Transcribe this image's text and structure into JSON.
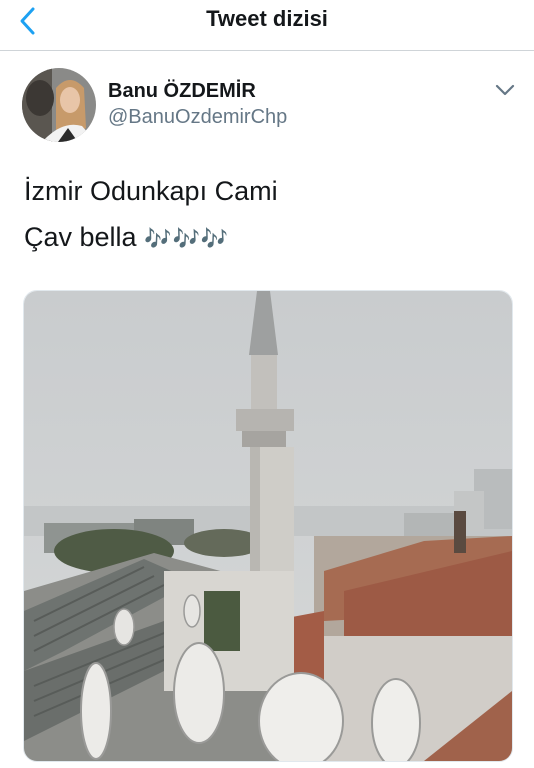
{
  "nav": {
    "title": "Tweet dizisi",
    "back_icon": "chevron-left-icon",
    "accent_color": "#1da1f2"
  },
  "tweet": {
    "author_name": "Banu ÖZDEMİR",
    "author_handle": "@BanuOzdemirChp",
    "menu_icon": "chevron-down-icon",
    "text_line1": "İzmir Odunkapı Cami",
    "text_line2": "Çav bella",
    "text_line2_emoji": "🎶🎶🎶",
    "media": "video-still-minaret-rooftops"
  }
}
